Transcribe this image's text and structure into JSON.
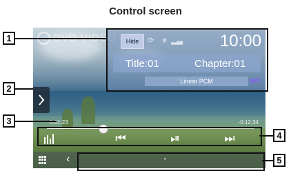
{
  "heading": "Control screen",
  "disc_label": "DVD VIDEO",
  "info": {
    "hide_label": "Hide",
    "clock": "10:00",
    "title": "Title:01",
    "chapter": "Chapter:01",
    "format": "Linear PCM",
    "off": "OFF"
  },
  "seek": {
    "elapsed": "0:01:23",
    "remaining": "-0:12:34",
    "progress": 0.27
  },
  "controls": {
    "eq_icon": "equalizer-icon",
    "prev": "⏮",
    "play_pause": "⏯",
    "next": "⏭"
  },
  "side_tab_icon": "chevron-right-icon",
  "callouts": [
    "1",
    "2",
    "3",
    "4",
    "5"
  ],
  "colors": {
    "callout": "#111111",
    "accent_off": "#8a57ff"
  }
}
